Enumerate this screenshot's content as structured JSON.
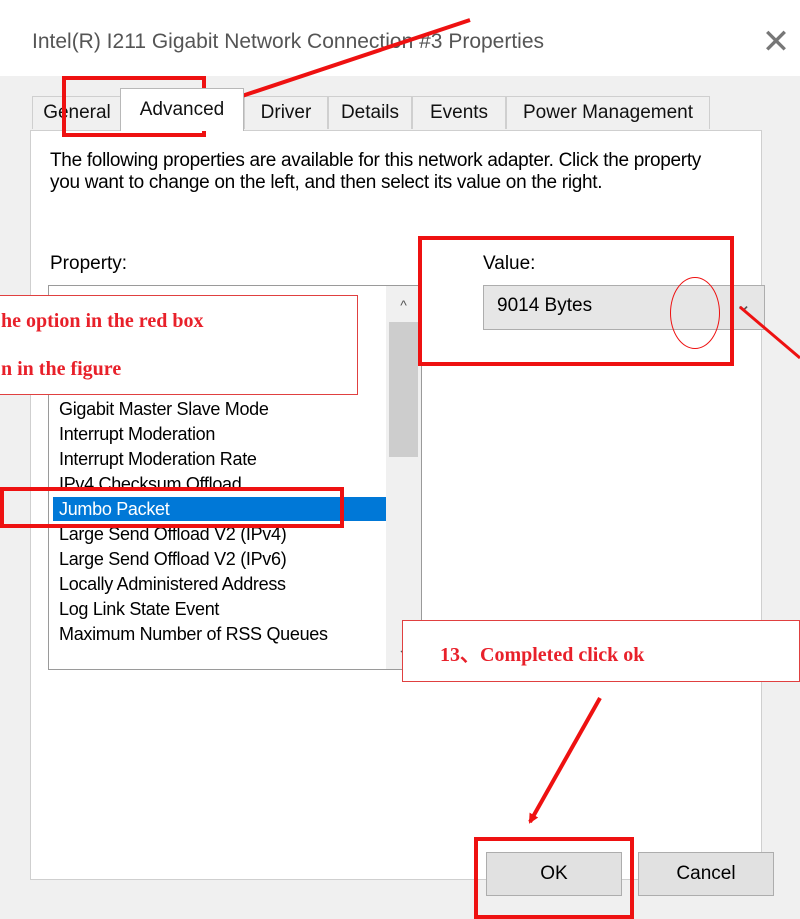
{
  "window": {
    "title": "Intel(R) I211 Gigabit Network Connection #3 Properties",
    "close_glyph": "✕"
  },
  "tabs": [
    {
      "label": "General"
    },
    {
      "label": "Advanced"
    },
    {
      "label": "Driver"
    },
    {
      "label": "Details"
    },
    {
      "label": "Events"
    },
    {
      "label": "Power Management"
    }
  ],
  "active_tab": "Advanced",
  "advanced": {
    "description": "The following properties are available for this network adapter. Click the property you want to change on the left, and then select its value on the right.",
    "property_label": "Property:",
    "value_label": "Value:",
    "properties": [
      {
        "label": "Gigabit Master Slave Mode"
      },
      {
        "label": "Interrupt Moderation"
      },
      {
        "label": "Interrupt Moderation Rate"
      },
      {
        "label": "IPv4 Checksum Offload"
      },
      {
        "label": "Jumbo Packet"
      },
      {
        "label": "Large Send Offload V2 (IPv4)"
      },
      {
        "label": "Large Send Offload V2 (IPv6)"
      },
      {
        "label": "Locally Administered Address"
      },
      {
        "label": "Log Link State Event"
      },
      {
        "label": "Maximum Number of RSS Queues"
      }
    ],
    "selected_property": "Jumbo Packet",
    "value": "9014 Bytes"
  },
  "buttons": {
    "ok": "OK",
    "cancel": "Cancel"
  },
  "annotations": {
    "callout_1_line1": "he option in the red box",
    "callout_1_line2": "n in the figure",
    "callout_2": "13、Completed click ok",
    "accent_color": "#ee1111"
  },
  "colors": {
    "selection": "#0078d7",
    "dialog_bg": "#f0f0f0"
  }
}
